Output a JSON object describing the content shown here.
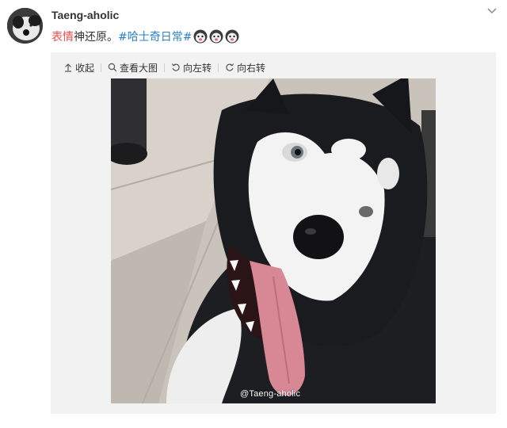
{
  "post": {
    "author": "Taeng-aholic",
    "text": {
      "keyword": "表情",
      "body": "神还原。",
      "topic": "#哈士奇日常#"
    },
    "emoticons": [
      "husky-face-icon",
      "husky-face-icon",
      "husky-face-icon"
    ]
  },
  "media_toolbar": {
    "collapse": "收起",
    "view_large": "查看大图",
    "rotate_left": "向左转",
    "rotate_right": "向右转"
  },
  "image": {
    "watermark": "@Taeng-aholic"
  },
  "colors": {
    "keyword": "#eb4b4b",
    "topic_link": "#2a80c4",
    "media_background": "#f2f2f2",
    "author_text": "#333333"
  }
}
